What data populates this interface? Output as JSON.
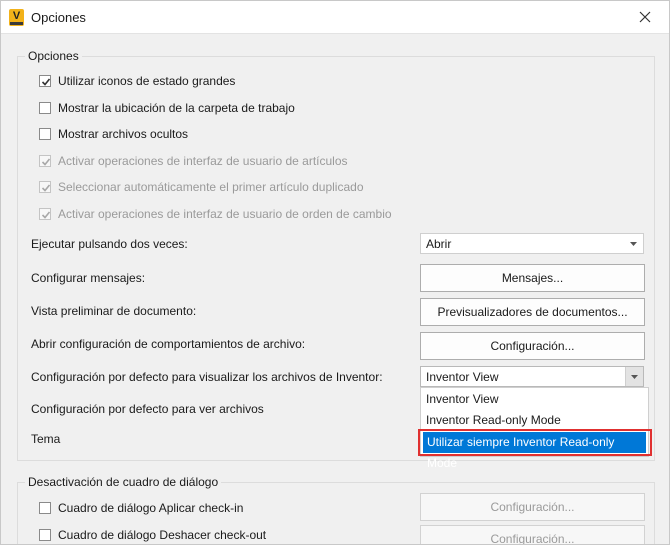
{
  "window": {
    "title": "Opciones",
    "app_icon_letter": "V"
  },
  "options_group": {
    "legend": "Opciones",
    "checkboxes": [
      {
        "label": "Utilizar iconos de estado grandes",
        "checked": true,
        "enabled": true
      },
      {
        "label": "Mostrar la ubicación de la carpeta de trabajo",
        "checked": false,
        "enabled": true
      },
      {
        "label": "Mostrar archivos ocultos",
        "checked": false,
        "enabled": true
      },
      {
        "label": "Activar operaciones de interfaz de usuario de artículos",
        "checked": true,
        "enabled": false
      },
      {
        "label": "Seleccionar automáticamente el primer artículo duplicado",
        "checked": true,
        "enabled": false
      },
      {
        "label": "Activar operaciones de interfaz de usuario de orden de cambio",
        "checked": true,
        "enabled": false
      }
    ],
    "double_click": {
      "label": "Ejecutar pulsando dos veces:",
      "value": "Abrir"
    },
    "messages": {
      "label": "Configurar mensajes:",
      "button": "Mensajes..."
    },
    "preview": {
      "label": "Vista preliminar de documento:",
      "button": "Previsualizadores de documentos..."
    },
    "file_behavior": {
      "label": "Abrir configuración de comportamientos de archivo:",
      "button": "Configuración..."
    },
    "inventor_default": {
      "label": "Configuración por defecto para visualizar los archivos de Inventor:",
      "value": "Inventor View",
      "options": [
        "Inventor View",
        "Inventor Read-only Mode",
        "Utilizar siempre Inventor Read-only Mode"
      ],
      "selected_index": 2
    },
    "view_default": {
      "label": "Configuración por defecto para ver archivos"
    },
    "theme": {
      "label": "Tema"
    }
  },
  "dialog_group": {
    "legend": "Desactivación de cuadro de diálogo",
    "rows": [
      {
        "label": "Cuadro de diálogo Aplicar check-in",
        "checked": false,
        "button": "Configuración..."
      },
      {
        "label": "Cuadro de diálogo Deshacer check-out",
        "checked": false,
        "button": "Configuración..."
      }
    ]
  },
  "colors": {
    "selection": "#0078d7",
    "highlight_border": "#e03030",
    "icon_accent": "#f2b21a"
  }
}
